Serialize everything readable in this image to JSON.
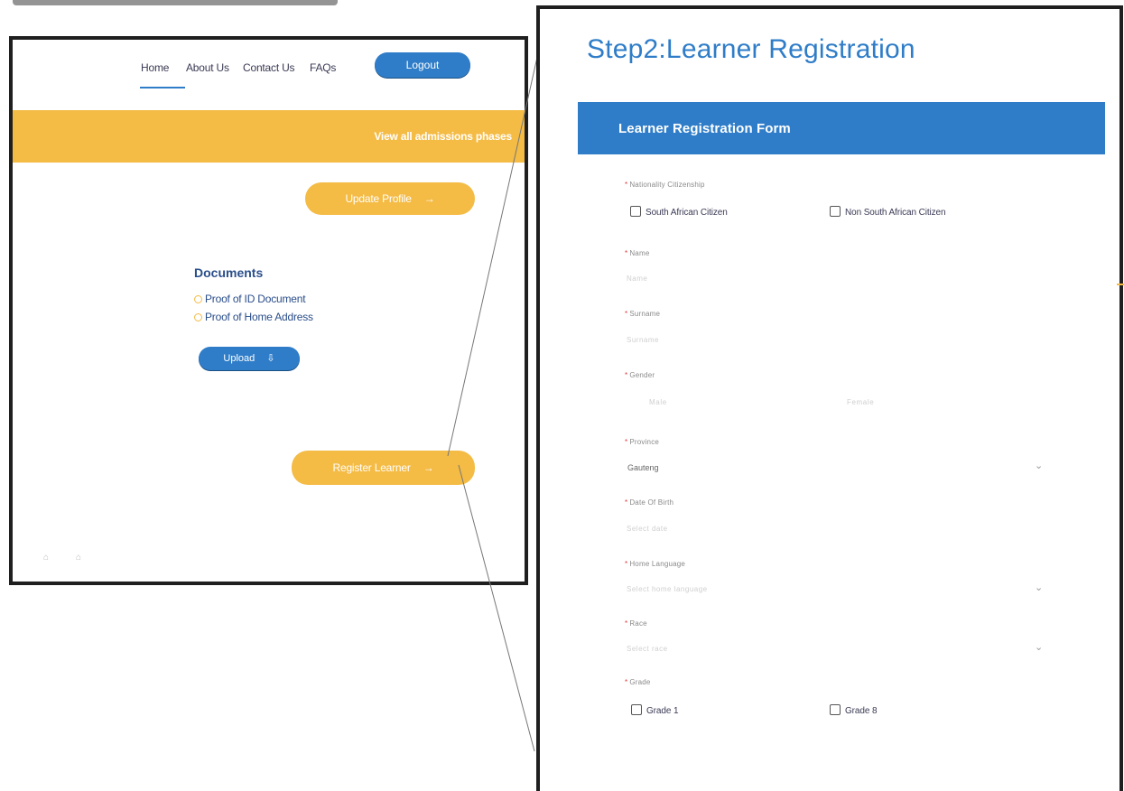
{
  "left_screen": {
    "nav": {
      "home": "Home",
      "about": "About Us",
      "contact": "Contact Us",
      "faqs": "FAQs",
      "logout": "Logout"
    },
    "banner_link": "View all admissions phases",
    "update_profile": "Update Profile",
    "arrow": "→",
    "documents": {
      "title": "Documents",
      "items": [
        "Proof of ID Document",
        "Proof of Home Address"
      ],
      "upload": "Upload",
      "upload_icon": "⇩"
    },
    "register_learner": "Register Learner"
  },
  "right_screen": {
    "title": "Step2:Learner Registration",
    "form_title": "Learner Registration Form",
    "required_marker": "*",
    "fields": {
      "nationality": {
        "label": "Nationality Citizenship",
        "options": [
          "South African Citizen",
          "Non South African Citizen"
        ]
      },
      "name": {
        "label": "Name",
        "placeholder": "Name"
      },
      "surname": {
        "label": "Surname",
        "placeholder": "Surname"
      },
      "gender": {
        "label": "Gender",
        "options": [
          "Male",
          "Female"
        ]
      },
      "province": {
        "label": "Province",
        "value": "Gauteng"
      },
      "dob": {
        "label": "Date Of Birth",
        "placeholder": "Select date"
      },
      "home_language": {
        "label": "Home Language",
        "placeholder": "Select home language"
      },
      "race": {
        "label": "Race",
        "placeholder": "Select race"
      },
      "grade": {
        "label": "Grade",
        "options": [
          "Grade 1",
          "Grade 8"
        ]
      }
    },
    "caret": "⌄"
  }
}
